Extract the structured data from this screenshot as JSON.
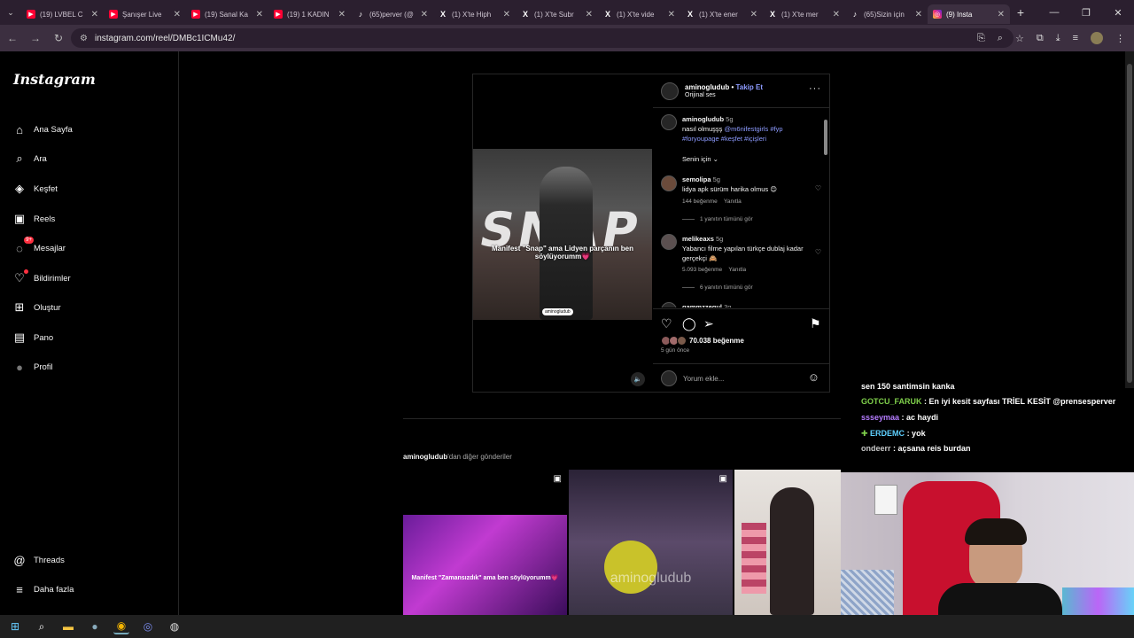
{
  "browser": {
    "tabs": [
      {
        "title": "(19) LVBEL C",
        "favicon": "yt"
      },
      {
        "title": "Şanışer Live",
        "favicon": "yt"
      },
      {
        "title": "(19) Sanal Ka",
        "favicon": "yt"
      },
      {
        "title": "(19) 1 KADIN",
        "favicon": "yt"
      },
      {
        "title": "(65)perver (@",
        "favicon": "tt"
      },
      {
        "title": "(1) X'te Hiph",
        "favicon": "x"
      },
      {
        "title": "(1) X'te Subr",
        "favicon": "x"
      },
      {
        "title": "(1) X'te vide",
        "favicon": "x"
      },
      {
        "title": "(1) X'te ener",
        "favicon": "x"
      },
      {
        "title": "(1) X'te mer",
        "favicon": "x"
      },
      {
        "title": "(65)Sizin için",
        "favicon": "tt"
      },
      {
        "title": "(9) Insta",
        "favicon": "ig",
        "active": true
      }
    ],
    "url": "instagram.com/reel/DMBc1ICMu42/"
  },
  "sidebar": {
    "logo": "Instagram",
    "items": [
      {
        "label": "Ana Sayfa",
        "icon": "home-icon"
      },
      {
        "label": "Ara",
        "icon": "search-icon"
      },
      {
        "label": "Keşfet",
        "icon": "compass-icon"
      },
      {
        "label": "Reels",
        "icon": "reels-icon"
      },
      {
        "label": "Mesajlar",
        "icon": "messenger-icon",
        "badge": "9+"
      },
      {
        "label": "Bildirimler",
        "icon": "heart-icon"
      },
      {
        "label": "Oluştur",
        "icon": "plus-square-icon"
      },
      {
        "label": "Pano",
        "icon": "dashboard-icon"
      },
      {
        "label": "Profil",
        "icon": "avatar"
      }
    ],
    "bottom": [
      {
        "label": "Threads",
        "icon": "threads-icon"
      },
      {
        "label": "Daha fazla",
        "icon": "menu-icon"
      }
    ]
  },
  "post": {
    "video_caption": "Manifest \"Snap\" ama Lidyen parçanın ben söylüyorumm💗",
    "video_text": "SNAP",
    "watermark": "aminogludub",
    "author": "aminogludub",
    "separator": " • ",
    "follow_label": "Takip Et",
    "audio": "Orijinal ses",
    "caption": {
      "user": "aminogludub",
      "time": "5g",
      "text": "nasıl olmuşşş ",
      "tags": "@m6nifestgirls #fyp #foryoupage #keşfet #içişleri"
    },
    "filter_label": "Senin için",
    "comments": [
      {
        "user": "semolipa",
        "time": "5g",
        "text": "lidya apk sürüm harika olmus 😊",
        "likes": "144 beğenme",
        "reply": "Yanıtla",
        "replies": "1 yanıtın tümünü gör"
      },
      {
        "user": "melikeaxs",
        "time": "5g",
        "text": "Yabancı filme yapılan türkçe dublaj kadar gerçekçi 🙈",
        "likes": "5.093 beğenme",
        "reply": "Yanıtla",
        "replies": "6 yanıtın tümünü gör"
      },
      {
        "user": "gammzzegul",
        "time": "3g",
        "text": ""
      }
    ],
    "likes": "70.038 beğenme",
    "ago": "5 gün önce",
    "comment_placeholder": "Yorum ekle..."
  },
  "more_from": {
    "user": "aminogludub",
    "suffix": "'dan diğer gönderiler",
    "thumbs": [
      {
        "caption": "Manifest \"Zamansızdık\" ama ben söylüyorumm💗"
      },
      {
        "caption": "aminogludub"
      },
      {
        "caption": ""
      }
    ]
  },
  "chat": [
    {
      "name": "",
      "text": "sen 150 santimsin kanka",
      "color": "#ffffff"
    },
    {
      "name": "GOTCU_FARUK",
      "text": " : En iyi kesit sayfası TRİEL KESİT @prensesperver",
      "color": "#7fd04b"
    },
    {
      "name": "ssseymaa",
      "text": " : ac haydi",
      "color": "#b57cff"
    },
    {
      "name": "ERDEMC",
      "text": " : yok",
      "color": "#5fd0ff"
    },
    {
      "name": "ondeerr",
      "text": " : açsana reis burdan",
      "color": "#c8c8c8"
    }
  ],
  "colors": {
    "accent": "#8d9bff",
    "notif": "#ff3040",
    "bg": "#000000"
  }
}
